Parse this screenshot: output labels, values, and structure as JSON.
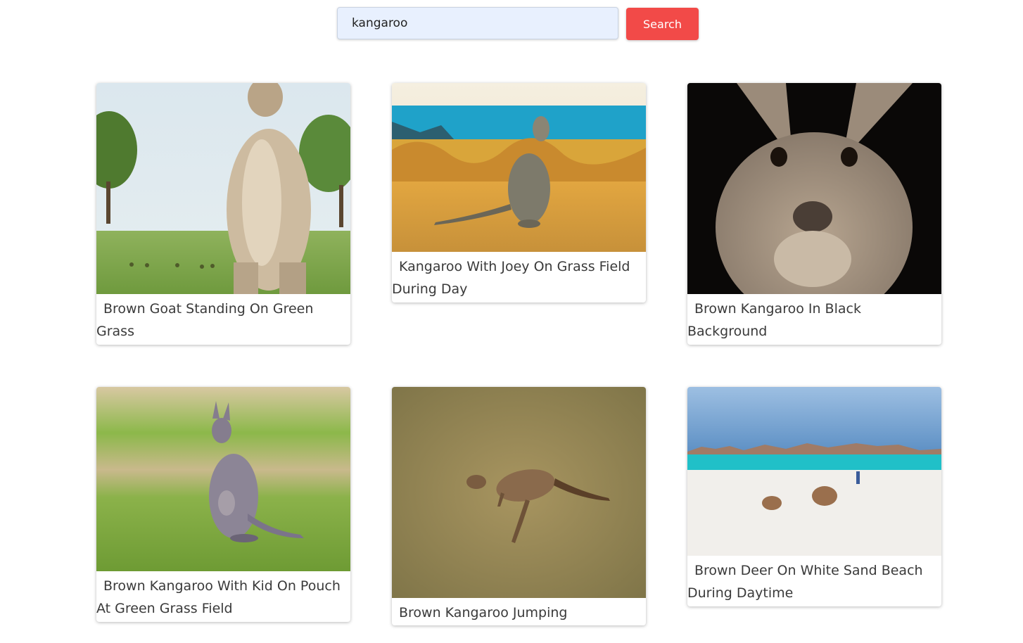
{
  "search": {
    "value": "kangaroo",
    "button_label": "Search"
  },
  "results": [
    {
      "title": "Brown Goat Standing On Green Grass",
      "image": "kangaroo-standing-photo"
    },
    {
      "title": "Kangaroo With Joey On Grass Field During Day",
      "image": "kangaroo-with-joey-photo"
    },
    {
      "title": "Brown Kangaroo In Black Background",
      "image": "kangaroo-portrait-photo"
    },
    {
      "title": "Brown Kangaroo With Kid On Pouch At Green Grass Field",
      "image": "kangaroo-with-kid-photo"
    },
    {
      "title": "Brown Kangaroo Jumping",
      "image": "kangaroo-jumping-photo"
    },
    {
      "title": "Brown Deer On White Sand Beach During Daytime",
      "image": "kangaroos-on-beach-photo"
    }
  ],
  "colors": {
    "accent": "#f24a48",
    "input_background": "#e8f0fe"
  }
}
